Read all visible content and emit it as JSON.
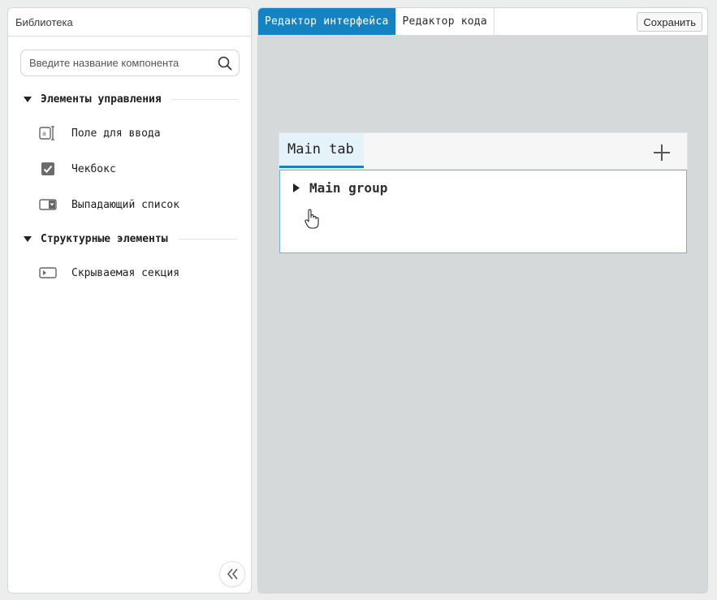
{
  "library": {
    "title": "Библиотека",
    "search": {
      "placeholder": "Введите название компонента",
      "value": ""
    },
    "groups": [
      {
        "label": "Элементы управления",
        "expanded": true,
        "items": [
          {
            "label": "Поле для ввода",
            "icon": "text-input-icon"
          },
          {
            "label": "Чекбокс",
            "icon": "checkbox-icon"
          },
          {
            "label": "Выпадающий список",
            "icon": "dropdown-icon"
          }
        ]
      },
      {
        "label": "Структурные элементы",
        "expanded": true,
        "items": [
          {
            "label": "Скрываемая секция",
            "icon": "collapsible-section-icon"
          }
        ]
      }
    ],
    "collapse_icon": "double-chevron-left-icon"
  },
  "editor": {
    "tabs": [
      {
        "label": "Редактор интерфейса",
        "active": true
      },
      {
        "label": "Редактор кода",
        "active": false
      }
    ],
    "save_label": "Сохранить",
    "canvas": {
      "form_tabs": [
        {
          "label": "Main tab",
          "active": true
        }
      ],
      "add_tab_icon": "plus-icon",
      "group": {
        "label": "Main group",
        "expanded": false
      }
    }
  },
  "colors": {
    "accent": "#1583c1",
    "canvas_bg": "#d6d9d9",
    "active_tab_bg": "#e4f2f9",
    "form_border": "#6fb5dd"
  }
}
